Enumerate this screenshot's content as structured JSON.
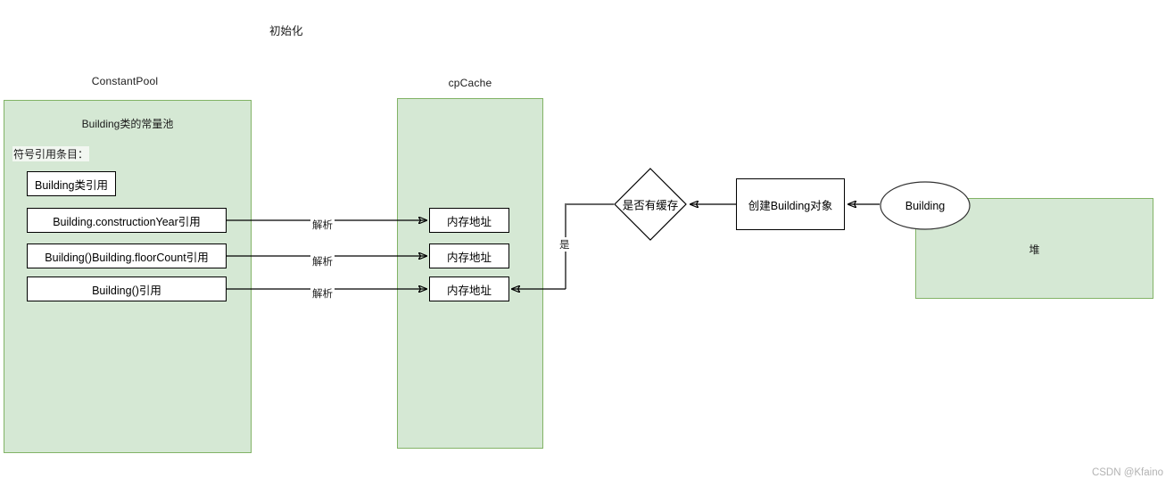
{
  "diagram": {
    "title": "初始化",
    "watermark": "CSDN @Kfaino"
  },
  "regions": {
    "constant_pool": {
      "title": "ConstantPool",
      "heading": "Building类的常量池",
      "sublabel": "符号引用条目：",
      "fill_color": "#d5e8d4",
      "stroke_color": "#82b366"
    },
    "cp_cache": {
      "title": "cpCache",
      "fill_color": "#d5e8d4",
      "stroke_color": "#82b366"
    },
    "heap": {
      "label": "堆",
      "fill_color": "#d5e8d4",
      "stroke_color": "#82b366"
    }
  },
  "constant_pool_entries": [
    {
      "label": "Building类引用"
    },
    {
      "label": "Building.constructionYear引用"
    },
    {
      "label": "Building()Building.floorCount引用"
    },
    {
      "label": "Building()引用"
    }
  ],
  "cp_cache_entries": [
    {
      "label": "内存地址"
    },
    {
      "label": "内存地址"
    },
    {
      "label": "内存地址"
    }
  ],
  "nodes": {
    "decision": {
      "label": "是否有缓存"
    },
    "create_object": {
      "label": "创建Building对象"
    },
    "building_instance": {
      "label": "Building"
    }
  },
  "edge_labels": {
    "resolve_1": "解析",
    "resolve_2": "解析",
    "resolve_3": "解析",
    "yes_branch": "是"
  }
}
